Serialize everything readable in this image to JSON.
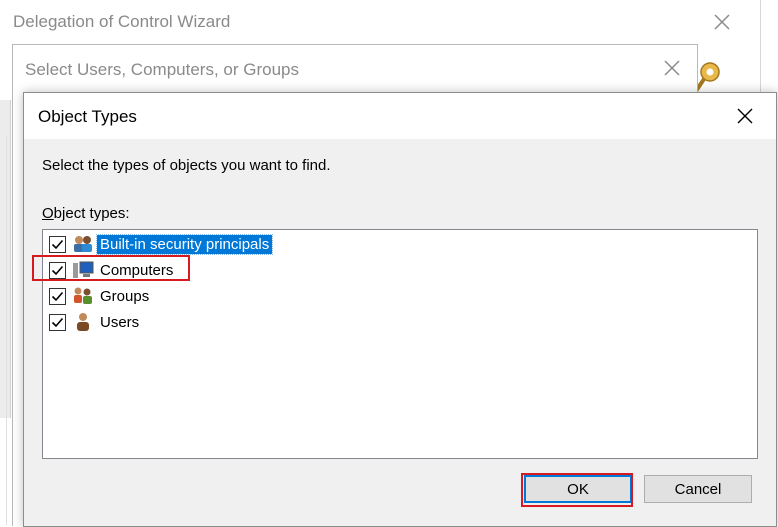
{
  "wizard": {
    "title": "Delegation of Control Wizard"
  },
  "select_dialog": {
    "title": "Select Users, Computers, or Groups"
  },
  "object_types_dialog": {
    "title": "Object Types",
    "instruction": "Select the types of objects you want to find.",
    "list_label_accel": "O",
    "list_label_rest": "bject types:",
    "items": [
      {
        "label": "Built-in security principals",
        "checked": true,
        "selected": true,
        "icon": "security-principals-icon"
      },
      {
        "label": "Computers",
        "checked": true,
        "selected": false,
        "icon": "computer-icon"
      },
      {
        "label": "Groups",
        "checked": true,
        "selected": false,
        "icon": "groups-icon"
      },
      {
        "label": "Users",
        "checked": true,
        "selected": false,
        "icon": "user-icon"
      }
    ],
    "ok_label": "OK",
    "cancel_label": "Cancel"
  },
  "colors": {
    "selection": "#0078d7",
    "highlight": "#d71920"
  }
}
